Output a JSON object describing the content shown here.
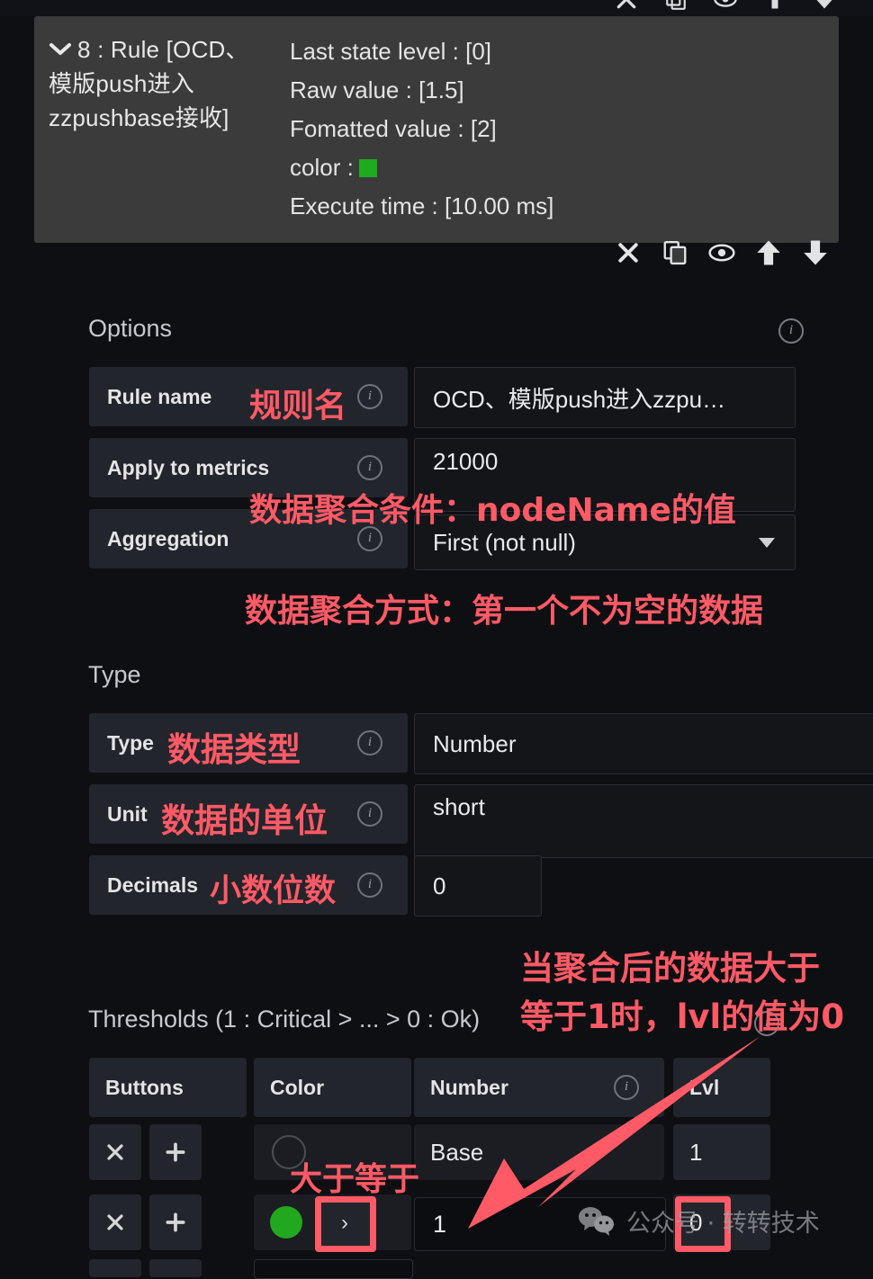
{
  "rule_card": {
    "title": "8 : Rule [OCD、模版push进入zzpushbase接收]",
    "title_line1": "8 : Rule [OCD、",
    "title_line2": "模版push进入",
    "title_line3": "zzpushbase接收]",
    "stats": [
      "Last state level : [0]",
      "Raw value : [1.5]",
      "Fomatted value : [2]"
    ],
    "color_label": "color :",
    "color_value": "#1fab1f",
    "execute_time": "Execute time : [10.00 ms]",
    "toolbar": [
      {
        "name": "close-icon",
        "label": "✕"
      },
      {
        "name": "duplicate-icon",
        "label": "copy"
      },
      {
        "name": "eye-icon",
        "label": "visibility"
      },
      {
        "name": "arrow-up-icon",
        "label": "move up"
      },
      {
        "name": "arrow-down-icon",
        "label": "move down"
      }
    ]
  },
  "options": {
    "heading": "Options",
    "rows": [
      {
        "label": "Rule name",
        "value": "OCD、模版push进入zzpu…"
      },
      {
        "label": "Apply to metrics",
        "value": "21000"
      },
      {
        "label": "Aggregation",
        "value": "First (not null)"
      }
    ]
  },
  "type_section": {
    "heading": "Type",
    "rows": [
      {
        "label": "Type",
        "value": "Number"
      },
      {
        "label": "Unit",
        "value": "short"
      },
      {
        "label": "Decimals",
        "value": "0"
      }
    ]
  },
  "thresholds": {
    "heading": "Thresholds (1 : Critical > ... > 0 : Ok)",
    "columns": [
      "Buttons",
      "Color",
      "Number",
      "Lvl"
    ],
    "rows": [
      {
        "remove": "✕",
        "add": "✚",
        "color": "",
        "operator": "",
        "number": "Base",
        "lvl": "1"
      },
      {
        "remove": "✕",
        "add": "✚",
        "color": "#22a81e",
        "operator": "›",
        "number": "1",
        "lvl": "0"
      }
    ]
  },
  "annotations": [
    {
      "id": "rule-name",
      "text": "规则名"
    },
    {
      "id": "metrics",
      "text": "数据聚合条件：nodeName的值"
    },
    {
      "id": "aggregation",
      "text": "数据聚合方式：第一个不为空的数据"
    },
    {
      "id": "type",
      "text": "数据类型"
    },
    {
      "id": "unit",
      "text": "数据的单位"
    },
    {
      "id": "decimals",
      "text": "小数位数"
    },
    {
      "id": "lvl-1",
      "text": "当聚合后的数据大于"
    },
    {
      "id": "lvl-2",
      "text": "等于1时，lvl的值为0"
    },
    {
      "id": "operator",
      "text": "大于等于"
    }
  ],
  "watermark": {
    "text": "公众号 · 转转技术"
  },
  "colors": {
    "accent_red": "#ff5a66",
    "ok_green": "#22a81e",
    "page_bg": "#0e0f13",
    "card_bg": "#3b3b3b",
    "label_bg": "#23252c",
    "input_bg": "#131519"
  }
}
